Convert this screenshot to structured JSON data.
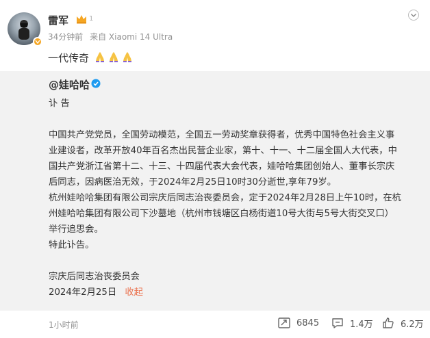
{
  "post": {
    "username": "雷军",
    "vip_level": "1",
    "time": "34分钟前",
    "source": "来自 Xiaomi 14 Ultra",
    "text": "一代传奇"
  },
  "repost": {
    "username": "@娃哈哈",
    "lines": [
      "讣 告",
      "",
      "中国共产党党员，全国劳动模范，全国五一劳动奖章获得者，优秀中国特色社会主义事",
      "业建设者，改革开放40年百名杰出民营企业家，第十、十一、十二届全国人大代表，中",
      "国共产党浙江省第十二、十三、十四届代表大会代表，娃哈哈集团创始人、董事长宗庆",
      "后同志，因病医治无效，于2024年2月25日10时30分逝世,享年79岁。",
      "杭州娃哈哈集团有限公司宗庆后同志治丧委员会，定于2024年2月28日上午10时，在杭",
      "州娃哈哈集团有限公司下沙墓地（杭州市钱塘区白杨街道10号大街与5号大街交叉口）",
      "举行追思会。",
      "特此讣告。",
      "",
      "宗庆后同志治丧委员会"
    ],
    "date": "2024年2月25日",
    "fold_label": "收起",
    "time_ago": "1小时前"
  },
  "actions": {
    "repost_count": "6845",
    "comment_count": "1.4万",
    "like_count": "6.2万"
  },
  "colors": {
    "accent": "#eb7350",
    "vip_gold": "#f5a623",
    "verify_blue": "#1d9bf0"
  },
  "icons": [
    "avatar-badge-icon",
    "vip-crown-icon",
    "more-chevron-icon",
    "pray-emoji-icon",
    "verified-icon",
    "repost-icon",
    "comment-icon",
    "like-icon"
  ]
}
